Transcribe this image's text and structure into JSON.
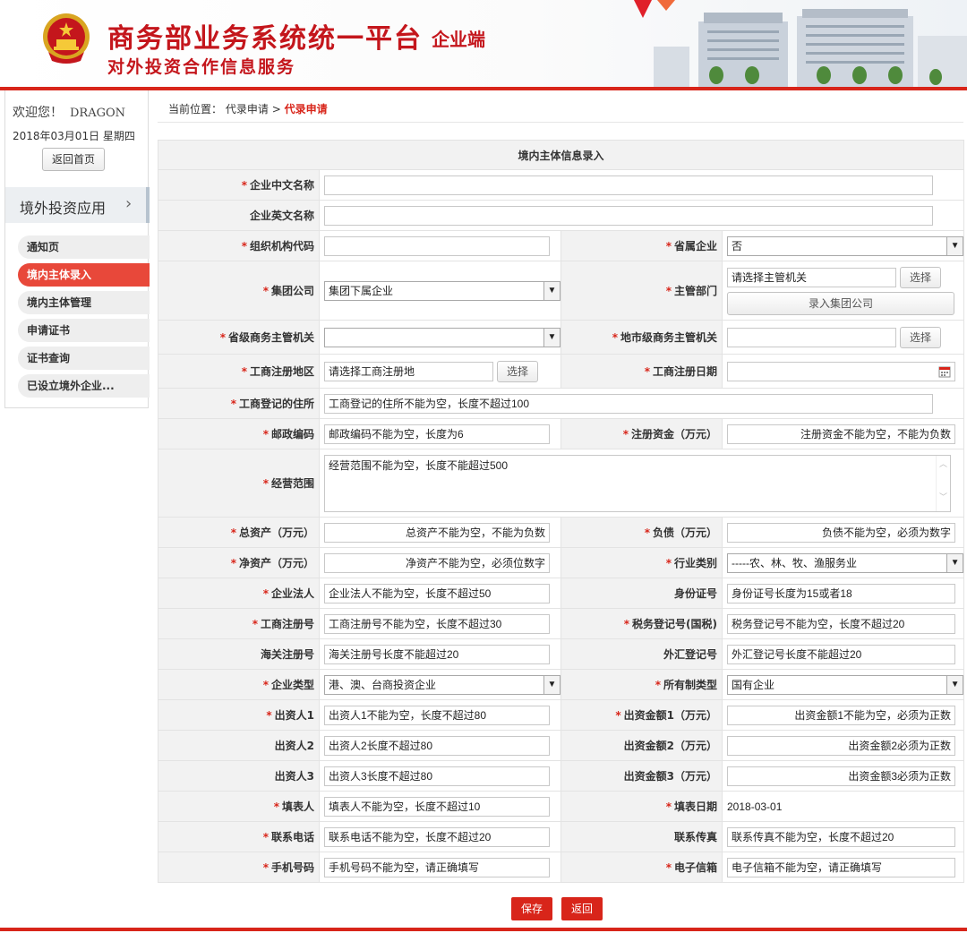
{
  "header": {
    "title": "商务部业务系统统一平台",
    "tag": "企业端",
    "subtitle": "对外投资合作信息服务"
  },
  "sidebar": {
    "welcome": "欢迎您！",
    "user": "DRAGON",
    "date": "2018年03月01日 星期四",
    "home_button": "返回首页",
    "menu_head": "境外投资应用",
    "items": [
      {
        "label": "通知页",
        "active": false
      },
      {
        "label": "境内主体录入",
        "active": true
      },
      {
        "label": "境内主体管理",
        "active": false
      },
      {
        "label": "申请证书",
        "active": false
      },
      {
        "label": "证书查询",
        "active": false
      },
      {
        "label": "已设立境外企业...",
        "active": false
      }
    ]
  },
  "breadcrumb": {
    "prefix": "当前位置：",
    "parent": "代录申请",
    "separator": ">",
    "current": "代录申请"
  },
  "form": {
    "title": "境内主体信息录入",
    "cn_name": {
      "label": "企业中文名称",
      "value": ""
    },
    "en_name": {
      "label": "企业英文名称",
      "value": ""
    },
    "org_code": {
      "label": "组织机构代码",
      "value": ""
    },
    "provincial": {
      "label": "省属企业",
      "value": "否"
    },
    "group": {
      "label": "集团公司",
      "value": "集团下属企业"
    },
    "dept": {
      "label": "主管部门",
      "value": "请选择主管机关",
      "select": "选择",
      "add_group": "录入集团公司"
    },
    "prov_authority": {
      "label": "省级商务主管机关",
      "value": ""
    },
    "city_authority": {
      "label": "地市级商务主管机关",
      "value": "",
      "select": "选择"
    },
    "reg_area": {
      "label": "工商注册地区",
      "value": "请选择工商注册地",
      "select": "选择"
    },
    "reg_date": {
      "label": "工商注册日期",
      "value": ""
    },
    "address": {
      "label": "工商登记的住所",
      "value": "工商登记的住所不能为空，长度不超过100"
    },
    "postcode": {
      "label": "邮政编码",
      "value": "邮政编码不能为空，长度为6"
    },
    "capital": {
      "label": "注册资金（万元）",
      "value": "注册资金不能为空，不能为负数"
    },
    "scope": {
      "label": "经营范围",
      "value": "经营范围不能为空，长度不能超过500"
    },
    "total_assets": {
      "label": "总资产（万元）",
      "value": "总资产不能为空，不能为负数"
    },
    "liabilities": {
      "label": "负债（万元）",
      "value": "负债不能为空，必须为数字"
    },
    "net_assets": {
      "label": "净资产（万元）",
      "value": "净资产不能为空，必须位数字"
    },
    "industry": {
      "label": "行业类别",
      "value": "-----农、林、牧、渔服务业"
    },
    "legal_person": {
      "label": "企业法人",
      "value": "企业法人不能为空，长度不超过50"
    },
    "id_no": {
      "label": "身份证号",
      "value": "身份证号长度为15或者18"
    },
    "biz_reg_no": {
      "label": "工商注册号",
      "value": "工商注册号不能为空，长度不超过30"
    },
    "tax_no": {
      "label": "税务登记号(国税)",
      "value": "税务登记号不能为空，长度不超过20"
    },
    "customs_no": {
      "label": "海关注册号",
      "value": "海关注册号长度不能超过20"
    },
    "fx_no": {
      "label": "外汇登记号",
      "value": "外汇登记号长度不能超过20"
    },
    "ent_type": {
      "label": "企业类型",
      "value": "港、澳、台商投资企业"
    },
    "ownership": {
      "label": "所有制类型",
      "value": "国有企业"
    },
    "investor1": {
      "label": "出资人1",
      "value": "出资人1不能为空，长度不超过80"
    },
    "amount1": {
      "label": "出资金额1（万元）",
      "value": "出资金额1不能为空，必须为正数"
    },
    "investor2": {
      "label": "出资人2",
      "value": "出资人2长度不超过80"
    },
    "amount2": {
      "label": "出资金额2（万元）",
      "value": "出资金额2必须为正数"
    },
    "investor3": {
      "label": "出资人3",
      "value": "出资人3长度不超过80"
    },
    "amount3": {
      "label": "出资金额3（万元）",
      "value": "出资金额3必须为正数"
    },
    "filler": {
      "label": "填表人",
      "value": "填表人不能为空，长度不超过10"
    },
    "fill_date": {
      "label": "填表日期",
      "value": "2018-03-01"
    },
    "phone": {
      "label": "联系电话",
      "value": "联系电话不能为空，长度不超过20"
    },
    "fax": {
      "label": "联系传真",
      "value": "联系传真不能为空，长度不超过20"
    },
    "mobile": {
      "label": "手机号码",
      "value": "手机号码不能为空，请正确填写"
    },
    "email": {
      "label": "电子信箱",
      "value": "电子信箱不能为空，请正确填写"
    }
  },
  "actions": {
    "save": "保存",
    "back": "返回"
  },
  "colors": {
    "brand_red": "#d8251a",
    "title_red": "#c4161c",
    "active_menu": "#e8483a",
    "label_bg": "#f2f2f2"
  },
  "icons": {
    "emblem": "national-emblem-icon",
    "chevron": "chevron-right-icon",
    "calendar": "calendar-icon",
    "dropdown": "dropdown-arrow-icon"
  }
}
